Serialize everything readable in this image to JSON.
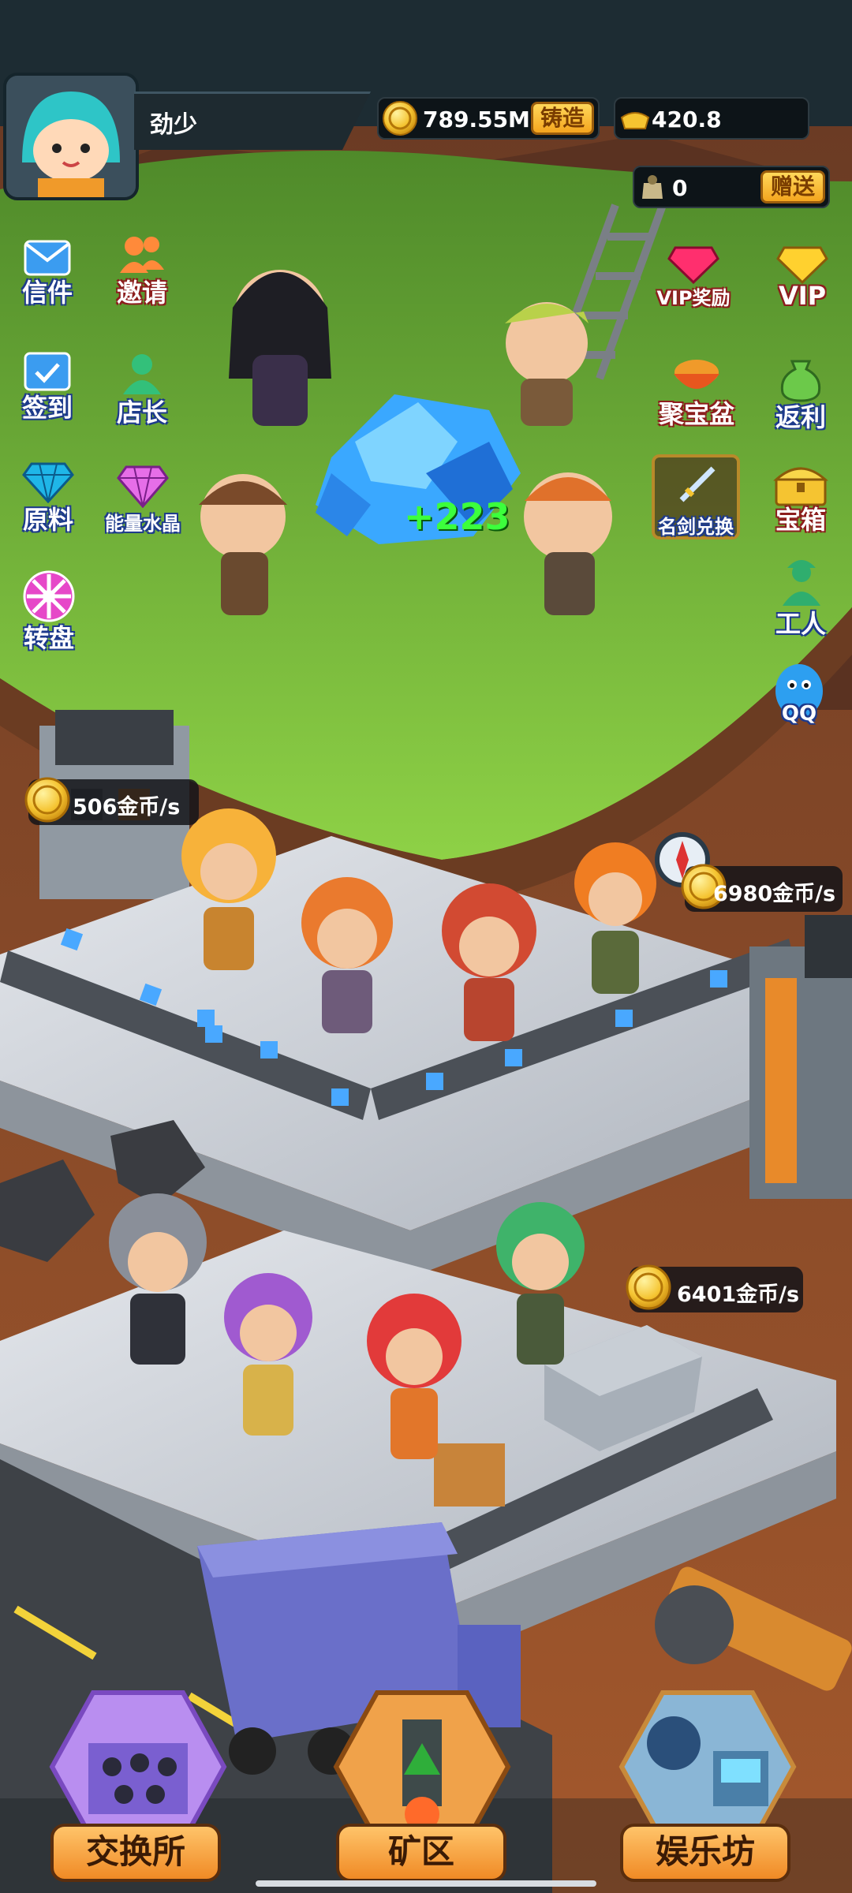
{
  "header": {
    "player_name": "劲少",
    "coins": "789.55M",
    "forge_label": "铸造",
    "gold": "420.8",
    "gift_count": "0",
    "gift_label": "赠送"
  },
  "left_menu": [
    {
      "label": "信件",
      "icon": "mail-icon"
    },
    {
      "label": "邀请",
      "icon": "invite-icon"
    },
    {
      "label": "签到",
      "icon": "calendar-icon"
    },
    {
      "label": "店长",
      "icon": "manager-icon"
    },
    {
      "label": "原料",
      "icon": "diamond-icon"
    },
    {
      "label": "能量水晶",
      "icon": "crystal-icon"
    },
    {
      "label": "转盘",
      "icon": "wheel-icon"
    }
  ],
  "right_menu": [
    {
      "label": "VIP奖励",
      "icon": "vip-reward-icon"
    },
    {
      "label": "VIP",
      "icon": "vip-icon"
    },
    {
      "label": "聚宝盆",
      "icon": "treasure-bowl-icon"
    },
    {
      "label": "返利",
      "icon": "rebate-icon"
    },
    {
      "label": "名剑兑换",
      "icon": "sword-exchange-icon"
    },
    {
      "label": "宝箱",
      "icon": "chest-icon"
    },
    {
      "label": "工人",
      "icon": "worker-icon"
    },
    {
      "label": "QQ",
      "icon": "qq-icon"
    }
  ],
  "scene": {
    "mine_gain": "+223",
    "rate_1": "506金币/s",
    "rate_2": "6980金币/s",
    "rate_3": "6401金币/s"
  },
  "bottom_nav": [
    {
      "label": "交换所"
    },
    {
      "label": "矿区"
    },
    {
      "label": "娱乐坊"
    }
  ],
  "colors": {
    "grass": "#7cc63a",
    "dirt": "#8a4a2a",
    "floor": "#c9cdd3",
    "accent": "#f7b733"
  }
}
